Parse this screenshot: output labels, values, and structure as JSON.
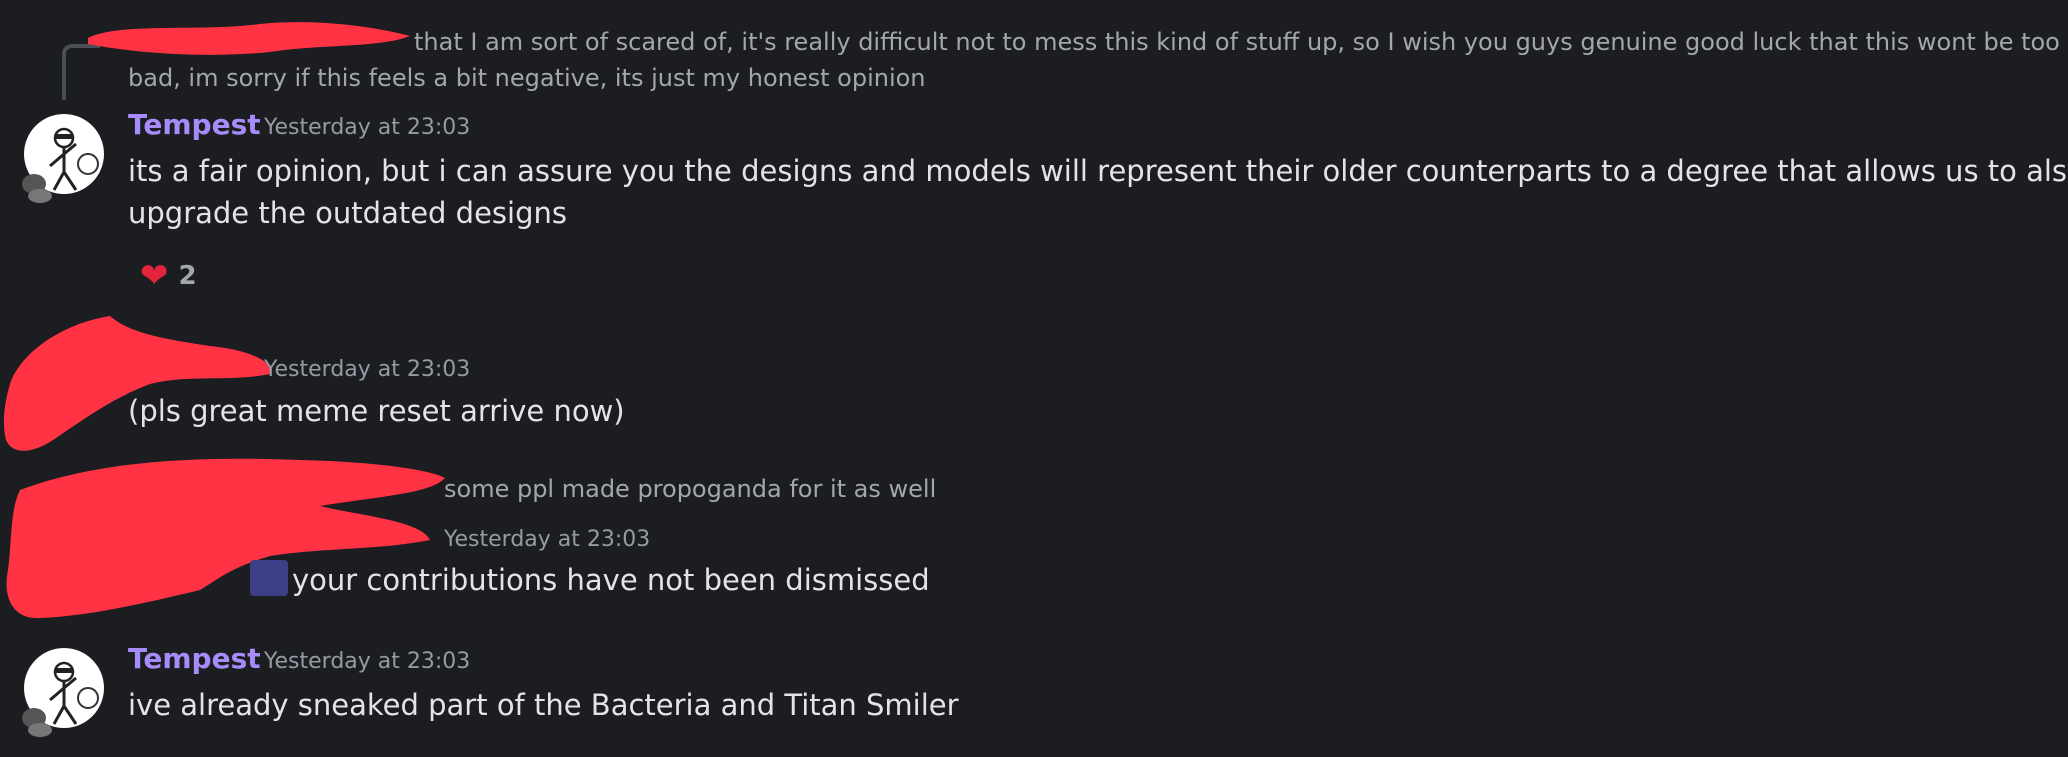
{
  "messages": [
    {
      "reply_preview": "that I am sort of scared of, it's really difficult not to mess this kind of stuff up, so I wish you guys genuine good luck that this wont be too",
      "reply_preview_2": "bad, im sorry if this feels a bit negative, its just my honest opinion",
      "author": "Tempest",
      "timestamp": "Yesterday at 23:03",
      "line1": "its a fair opinion, but i can assure you the designs and models will represent their older counterparts to a degree that allows us to also",
      "line2": "upgrade the outdated designs",
      "reaction": {
        "emoji": "❤",
        "count": "2"
      }
    },
    {
      "timestamp": "Yesterday at 23:03",
      "text": "(pls great meme reset arrive now)"
    },
    {
      "reply_preview": "some ppl made propoganda for it as well",
      "timestamp": "Yesterday at 23:03",
      "text": "your contributions have not been dismissed"
    },
    {
      "author": "Tempest",
      "timestamp": "Yesterday at 23:03",
      "text": "ive already sneaked part of the Bacteria and Titan Smiler"
    }
  ],
  "colors": {
    "background": "#1c1d21",
    "author": "#a78bfa",
    "redaction": "#ff3344",
    "reaction": "#e3243b"
  },
  "icons": [
    "heart-emoji",
    "avatar-tempest"
  ]
}
